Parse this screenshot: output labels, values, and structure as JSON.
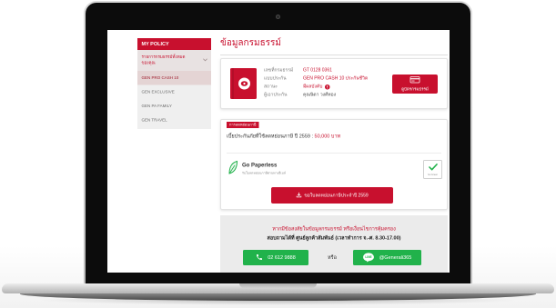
{
  "colors": {
    "brand_red": "#c8102e",
    "action_green": "#21b24b",
    "sidebar_bg": "#efefef",
    "contact_bg": "#ebebeb"
  },
  "bezel": {
    "icon": "webcam-icon"
  },
  "sidebar": {
    "header": "MY POLICY",
    "all_policies": {
      "label": "รายการกรมธรรม์ทั้งหมด ของคุณ",
      "icon": "chevron-down-icon",
      "expanded": true
    },
    "items": [
      {
        "label": "GEN PRO CASH 10",
        "active": true
      },
      {
        "label": "GEN EXCLUSIVE",
        "active": false
      },
      {
        "label": "GEN PA FAMILY",
        "active": false
      },
      {
        "label": "GEN TRAVEL",
        "active": false
      }
    ]
  },
  "main": {
    "title": "ข้อมูลกรมธรรม์",
    "policy": {
      "icon": "policy-book-icon",
      "rows": [
        {
          "label": "เลขที่กรมธรรม์",
          "value": "GT 0128 0361"
        },
        {
          "label": "แบบประกัน",
          "value": "GEN PRO CASH 10 ประกันชีวิต"
        },
        {
          "label": "สถานะ",
          "value": "มีผลบังคับ",
          "icon": "status-alert-icon"
        },
        {
          "label": "ผู้เอาประกัน",
          "value": "คุณนิดา วงศ์ทอง"
        }
      ],
      "view_card_button": {
        "label": "ดูบัตรกรมธรรม์",
        "icon": "card-icon"
      }
    },
    "tax": {
      "tag": "การลดหย่อนภาษี",
      "premium_prefix": "เบี้ยประกันภัยที่ใช้ลดหย่อนภาษี ปี 2559 : ",
      "premium_amount": "50,000 บาท",
      "paperless": {
        "icon": "leaf-icon",
        "title": "Go Paperless",
        "subtitle": "รับใบลดหย่อนภาษีผ่านทางอีเมล์",
        "checkbox_label": "Go Green",
        "checked": true,
        "check_icon": "checkmark-icon"
      },
      "request_button": {
        "label": "ขอใบลดหย่อนภาษีประจำปี 2559",
        "icon": "download-icon"
      }
    },
    "contact": {
      "line1": "หากมีข้อสงสัยในข้อมูลกรมธรรม์ หรือเงื่อนไขการคุ้มครอง",
      "line2": "สอบถามได้ที่ ศูนย์ลูกค้าสัมพันธ์ (เวลาทำการ จ.-ศ. 8.30-17.00)",
      "phone_button": {
        "label": "02 612 9888",
        "icon": "phone-icon"
      },
      "or_label": "หรือ",
      "line_button": {
        "label": "@Generali365",
        "icon": "line-logo-icon",
        "logo_text": "LINE"
      }
    }
  }
}
